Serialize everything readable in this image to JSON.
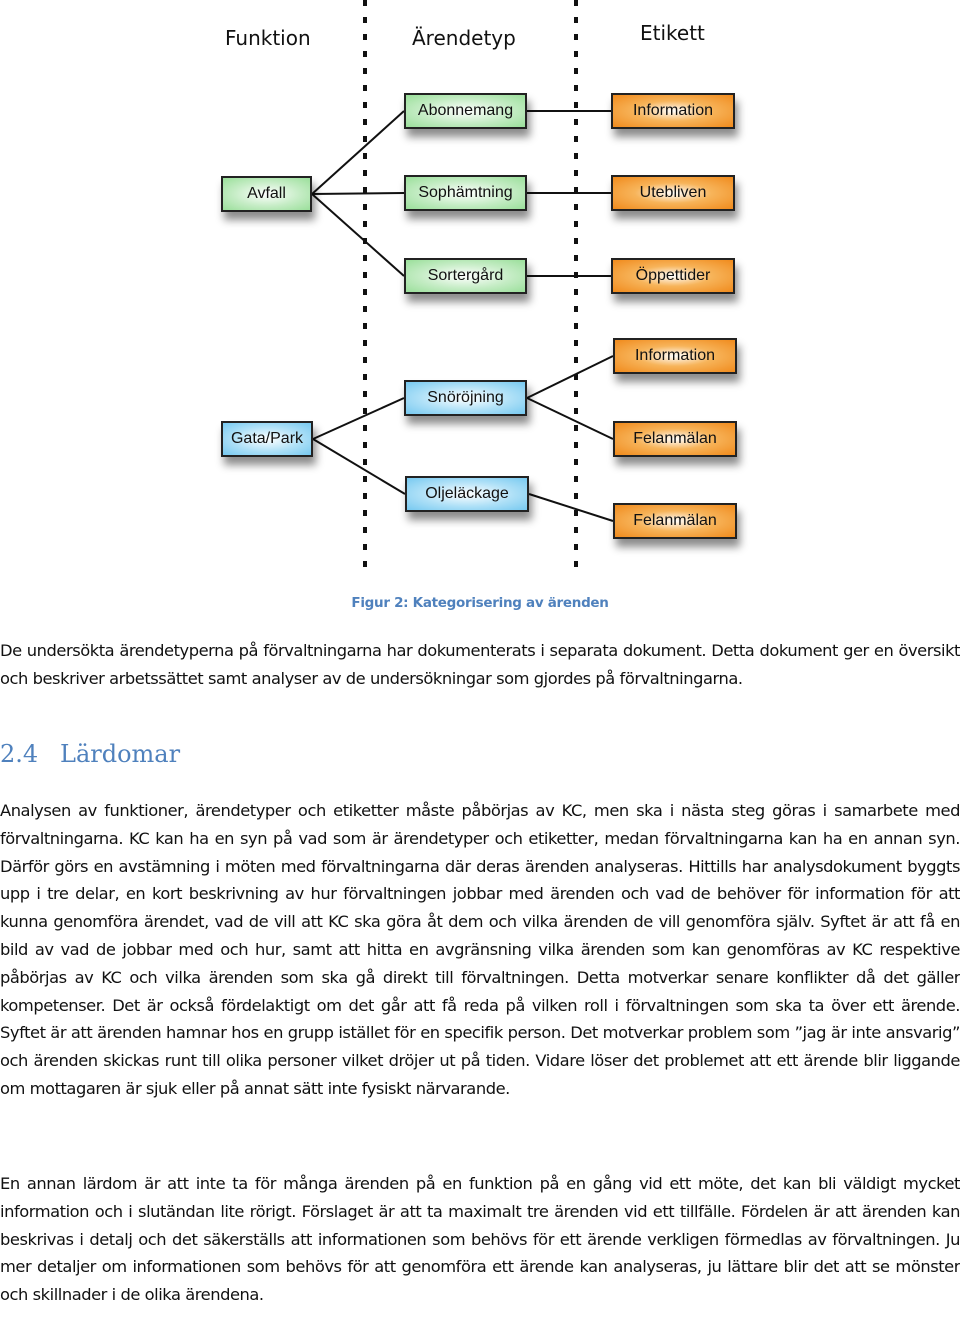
{
  "figure": {
    "columns": [
      "Funktion",
      "Ärendetyp",
      "Etikett"
    ],
    "functions": [
      {
        "id": "avfall",
        "label": "Avfall",
        "color": "green"
      },
      {
        "id": "gata",
        "label": "Gata/Park",
        "color": "blue"
      }
    ],
    "types": [
      {
        "id": "abonnemang",
        "label": "Abonnemang",
        "color": "green",
        "parent": "avfall"
      },
      {
        "id": "sophamtning",
        "label": "Sophämtning",
        "color": "green",
        "parent": "avfall"
      },
      {
        "id": "sortergard",
        "label": "Sortergård",
        "color": "green",
        "parent": "avfall"
      },
      {
        "id": "snorojning",
        "label": "Snöröjning",
        "color": "blue",
        "parent": "gata"
      },
      {
        "id": "oljelackage",
        "label": "Oljeläckage",
        "color": "blue",
        "parent": "gata"
      }
    ],
    "labels": [
      {
        "id": "l1",
        "label": "Information",
        "parent": "abonnemang"
      },
      {
        "id": "l2",
        "label": "Utebliven",
        "parent": "sophamtning"
      },
      {
        "id": "l3",
        "label": "Öppettider",
        "parent": "sortergard"
      },
      {
        "id": "l4",
        "label": "Information",
        "parent": "snorojning"
      },
      {
        "id": "l5",
        "label": "Felanmälan",
        "parent": "snorojning"
      },
      {
        "id": "l6",
        "label": "Felanmälan",
        "parent": "oljelackage"
      }
    ],
    "colors": {
      "green": "#9adf9a",
      "blue": "#77c9f0",
      "orange": "#f08a1c",
      "accent": "#4f81bd"
    },
    "caption": "Figur 2: Kategorisering av ärenden"
  },
  "intro_paragraph": "De undersökta ärendetyperna på förvaltningarna har dokumenterats i separata dokument. Detta dokument ger en översikt och beskriver arbetssättet samt analyser av de undersökningar som gjordes på förvaltningarna.",
  "section": {
    "number": "2.4",
    "title": "Lärdomar",
    "paragraphs": [
      "Analysen av funktioner, ärendetyper och etiketter måste påbörjas av KC, men ska i nästa steg göras i samarbete med förvaltningarna. KC kan ha en syn på vad som är ärendetyper och etiketter, medan förvaltningarna kan ha en annan syn. Därför görs en avstämning i möten med förvaltningarna där deras ärenden analyseras. Hittills har analysdokument byggts upp i tre delar, en kort beskrivning av hur förvaltningen jobbar med ärenden och vad de behöver för information för att kunna genomföra ärendet, vad de vill att KC ska göra åt dem och vilka ärenden de vill genomföra själv. Syftet är att få en bild av vad de jobbar med och hur, samt att hitta en avgränsning vilka ärenden som kan genomföras av KC respektive påbörjas av KC och vilka ärenden som ska gå direkt till förvaltningen. Detta motverkar senare konflikter då det gäller kompetenser. Det är också fördelaktigt om det går att få reda på vilken roll i förvaltningen som ska ta över ett ärende. Syftet är att ärenden hamnar hos en grupp istället för en specifik person. Det motverkar problem som ”jag är inte ansvarig” och ärenden skickas runt till olika personer vilket dröjer ut på tiden. Vidare löser det problemet att ett ärende blir liggande om mottagaren är sjuk eller på annat sätt inte fysiskt närvarande.",
      "En annan lärdom är att inte ta för många ärenden på en funktion på en gång vid ett möte, det kan bli väldigt mycket information och i slutändan lite rörigt. Förslaget är att ta maximalt tre ärenden vid ett tillfälle. Fördelen är att ärenden kan beskrivas i detalj och det säkerställs att informationen som behövs för ett ärende verkligen förmedlas av förvaltningen. Ju mer detaljer om informationen som behövs för att genomföra ett ärende kan analyseras, ju lättare blir det att se mönster och skillnader i de olika ärendena."
    ]
  }
}
